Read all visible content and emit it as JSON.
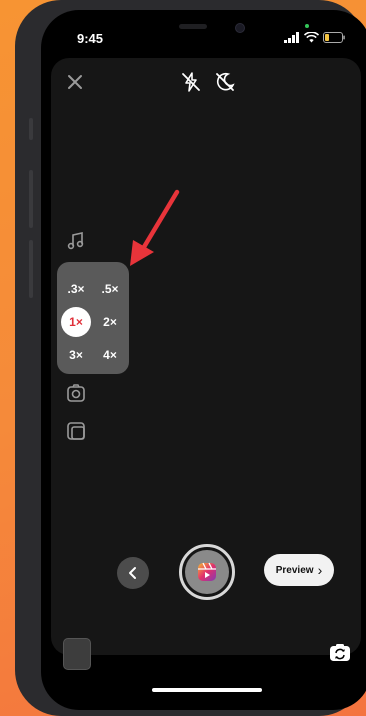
{
  "status_bar": {
    "time": "9:45"
  },
  "top_controls": {
    "close_icon": "close-icon",
    "flash_icon": "flash-off-icon",
    "night_icon": "night-mode-off-icon"
  },
  "side_tools": {
    "music_icon": "music-note-icon",
    "timer_icon": "timer-icon",
    "layout_icon": "layout-icon"
  },
  "zoom": {
    "options": [
      ".3×",
      ".5×",
      "1×",
      "2×",
      "3×",
      "4×"
    ],
    "selected": "1×"
  },
  "bottom": {
    "preview_label": "Preview",
    "preview_chevron": "›"
  },
  "colors": {
    "background_gradient_top": "#f79433",
    "background_gradient_bottom": "#f4733f",
    "annotation_arrow": "#e8343a",
    "zoom_selected_text": "#e0303a",
    "zoom_panel": "#5a5a5a"
  }
}
